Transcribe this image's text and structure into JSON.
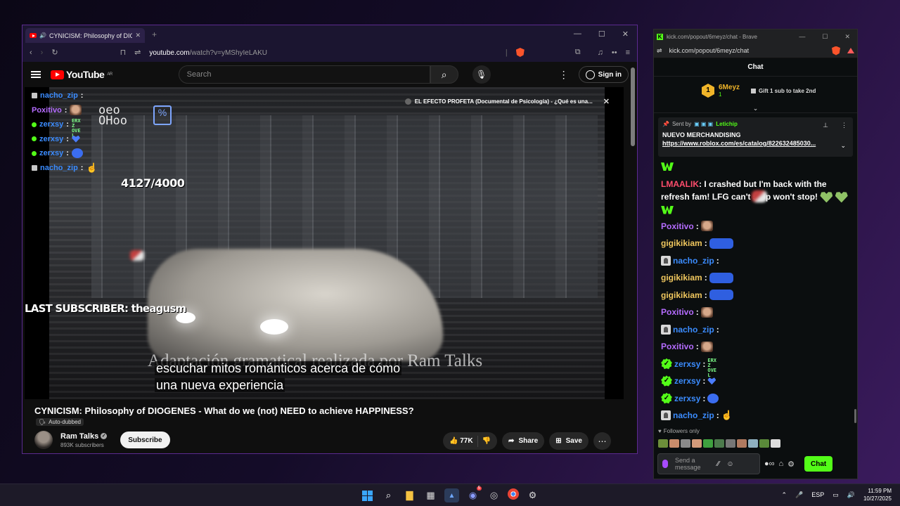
{
  "youtube_window": {
    "tab_title": "CYNICISM: Philosophy of DIO",
    "url_host": "youtube.com",
    "url_path": "/watch?v=yMShyIeLAKU",
    "logo_text": "YouTube",
    "logo_region": "AR",
    "search_placeholder": "Search",
    "signin_label": "Sign in",
    "video": {
      "overlay_chat": [
        {
          "user": "nacho_zip",
          "color": "#3b8cff"
        },
        {
          "user": "Poxitivo",
          "color": "#b56cff"
        },
        {
          "user": "zerxsy",
          "color": "#3b8cff"
        },
        {
          "user": "zerxsy",
          "color": "#3b8cff"
        },
        {
          "user": "zerxsy",
          "color": "#3b8cff"
        },
        {
          "user": "nacho_zip",
          "color": "#3b8cff"
        }
      ],
      "overlay_logo_text": "oeo\nOHoo",
      "overlay_logo_pct": "%",
      "counter": "4127/4000",
      "last_subscriber": "LAST SUBSCRIBER: theagusm",
      "recommendation": "EL EFECTO PROFETA (Documental de Psicología) - ¿Qué es una...",
      "burned_caption": "Adaptación gramatical realizada por Ram Talks",
      "subtitle_line1": "escuchar mitos románticos acerca de cómo",
      "subtitle_line2": "una nueva experiencia"
    },
    "title": "CYNICISM: Philosophy of DIOGENES - What do we (not) NEED to achieve HAPPINESS?",
    "auto_dubbed": "Auto-dubbed",
    "channel_name": "Ram Talks",
    "subscribers": "893K subscribers",
    "subscribe_label": "Subscribe",
    "likes": "77K",
    "share_label": "Share",
    "save_label": "Save"
  },
  "kick_window": {
    "window_title": "kick.com/popout/6meyz/chat - Brave",
    "url": "kick.com/popout/6meyz/chat",
    "chat_header": "Chat",
    "top_gifter": {
      "rank": "1",
      "name": "6Meyz",
      "count": "1",
      "gift_label": "Gift 1 sub to take 2nd"
    },
    "pinned": {
      "sent_by": "Sent by",
      "sender": "Letichip",
      "title": "NUEVO MERCHANDISING",
      "link": "https://www.roblox.com/es/catalog/822632485030..."
    },
    "messages": [
      {
        "user": "LMAALIK",
        "color": "#ff4d6d",
        "text": "I crashed but I'm back with the refresh fam! LFG can't stop won't stop!"
      },
      {
        "user": "Poxitivo",
        "color": "#b56cff"
      },
      {
        "user": "gigikikiam",
        "color": "#f0c75e"
      },
      {
        "user": "nacho_zip",
        "color": "#3b8cff"
      },
      {
        "user": "gigikikiam",
        "color": "#f0c75e"
      },
      {
        "user": "gigikikiam",
        "color": "#f0c75e"
      },
      {
        "user": "Poxitivo",
        "color": "#b56cff"
      },
      {
        "user": "nacho_zip",
        "color": "#3b8cff"
      },
      {
        "user": "Poxitivo",
        "color": "#b56cff"
      },
      {
        "user": "zerxsy",
        "color": "#3b8cff"
      },
      {
        "user": "zerxsy",
        "color": "#3b8cff"
      },
      {
        "user": "zerxsy",
        "color": "#3b8cff"
      },
      {
        "user": "nacho_zip",
        "color": "#3b8cff"
      }
    ],
    "followers_only": "Followers only",
    "send_placeholder": "Send a message",
    "chat_button": "Chat"
  },
  "taskbar": {
    "language": "ESP",
    "time": "11:59 PM",
    "date": "10/27/2025",
    "discord_badge": "5"
  },
  "colors": {
    "kick_green": "#53fc18",
    "youtube_red": "#ff0000",
    "brave_orange": "#fb542b"
  }
}
